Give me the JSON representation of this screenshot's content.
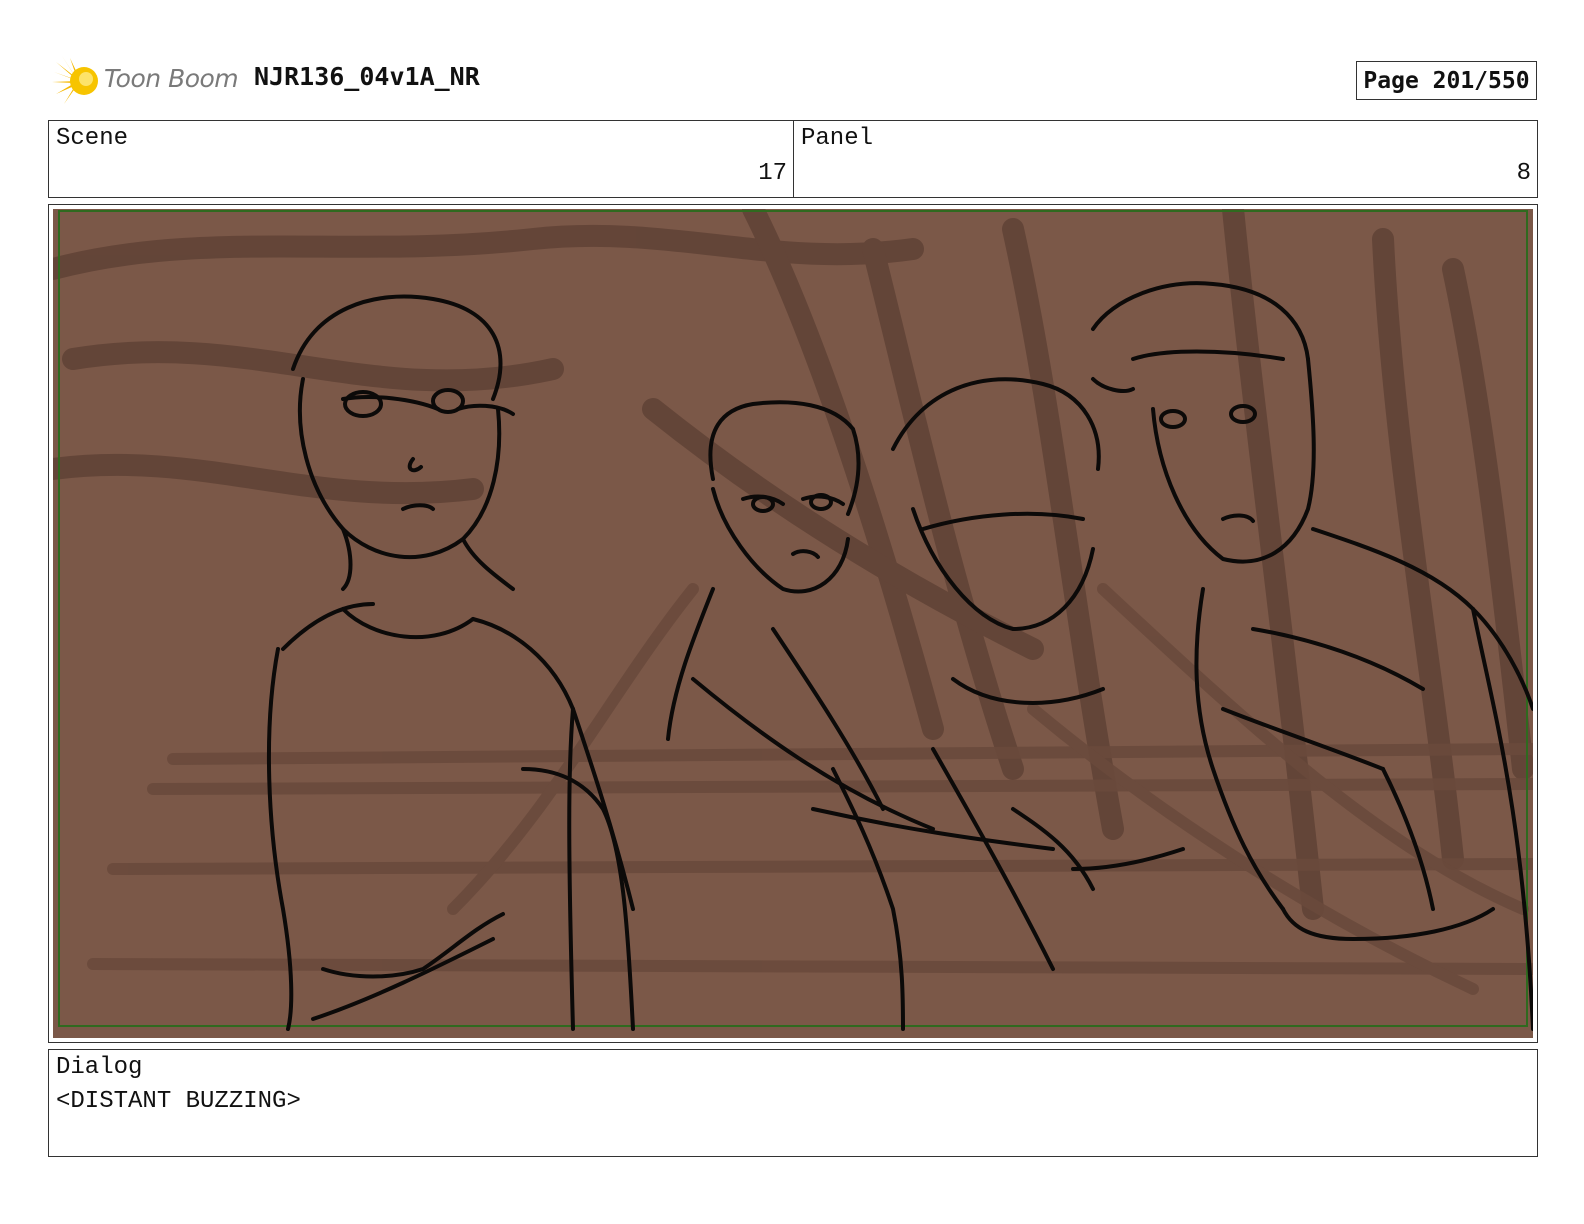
{
  "header": {
    "logo_text": "Toon Boom",
    "project_title": "NJR136_04v1A_NR",
    "page_label": "Page 201/550"
  },
  "info": {
    "scene_label": "Scene",
    "scene_value": "17",
    "panel_label": "Panel",
    "panel_value": "8"
  },
  "frame": {
    "background_color": "#7b5848",
    "safe_area_color": "#2f6a1f",
    "content": "storyboard-sketch"
  },
  "dialog": {
    "label": "Dialog",
    "text": "<DISTANT BUZZING>"
  }
}
